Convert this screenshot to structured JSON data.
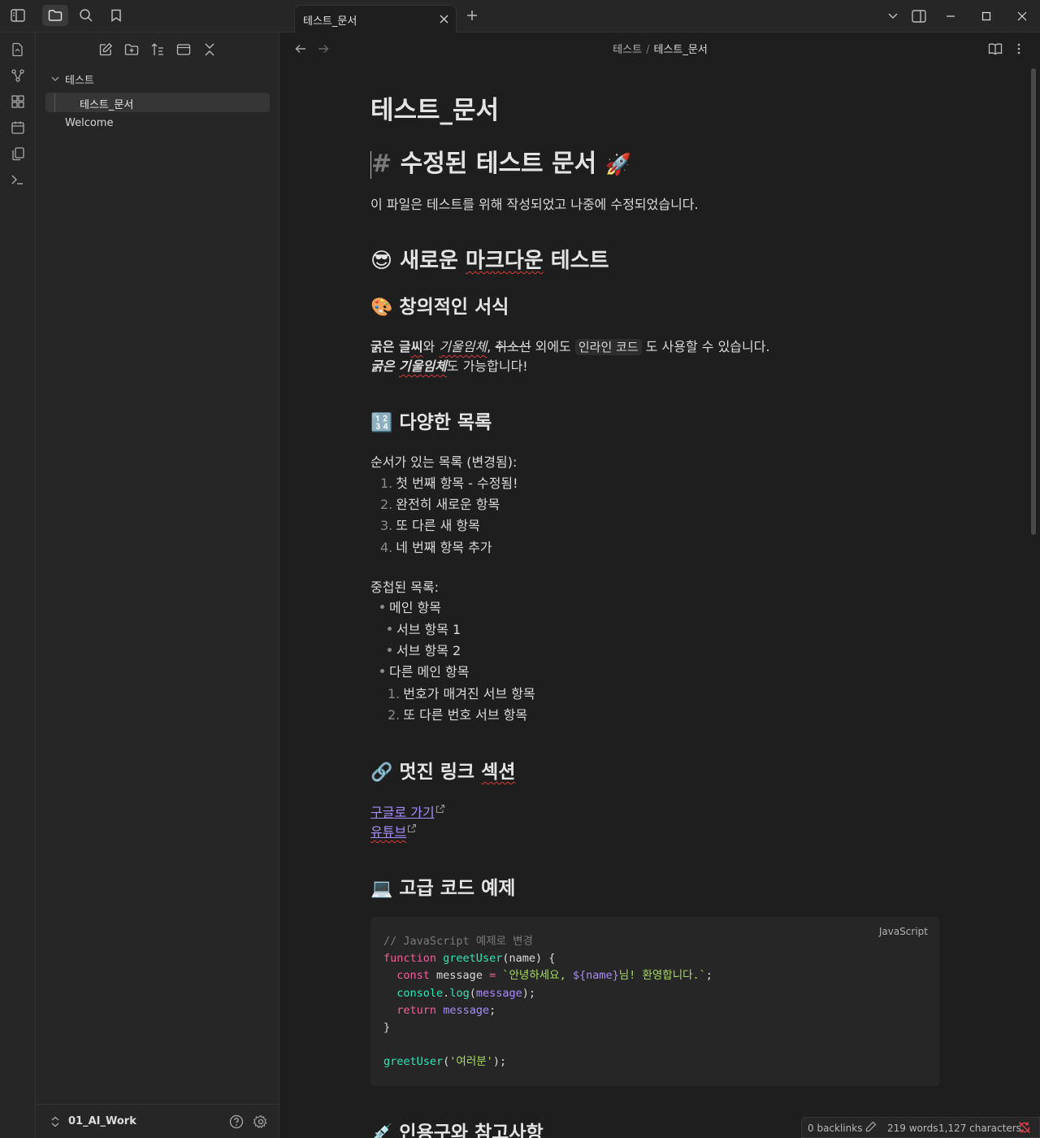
{
  "titlebar": {
    "tab_title": "테스트_문서"
  },
  "sidebar": {
    "folder": "테스트",
    "files": [
      "테스트_문서",
      "Welcome"
    ],
    "vault_name": "01_AI_Work"
  },
  "header": {
    "breadcrumb_parent": "테스트",
    "breadcrumb_sep": "/",
    "breadcrumb_current": "테스트_문서"
  },
  "doc": {
    "inline_title": "테스트_문서",
    "h1_hash": "#",
    "h1": "수정된 테스트 문서",
    "h1_emoji": "🚀",
    "intro": "이 파일은 테스트를 위해 작성되었고 나중에 수정되었습니다.",
    "h2_emoji": "😎",
    "h2_a": "새로운",
    "h2_b": "마크다운",
    "h2_c": "테스트",
    "h3_format_emoji": "🎨",
    "h3_format": "창의적인 서식",
    "fmt_line1": {
      "bold_a": "굵은 글",
      "bold_b": "씨",
      "t1": "와 ",
      "italic_a": "기울임체",
      "t2": ", ",
      "strike": "취소선",
      "t3": " 외에도 ",
      "code": "인라인 코드",
      "t4": " 도 사용할 수 있습니다."
    },
    "fmt_line2": {
      "bi_a": "굵은 ",
      "bi_b": "기울임체",
      "t": "도 가능합니다!"
    },
    "h3_list_emoji": "🔢",
    "h3_list": "다양한 목록",
    "ordered_label": "순서가 있는 목록 (변경됨):",
    "ordered": [
      "첫 번째 항목 - 수정됨!",
      "완전히 새로운 항목",
      "또 다른 새 항목",
      "네 번째 항목 추가"
    ],
    "nested_label": "중첩된 목록:",
    "nested": {
      "main1": "메인 항목",
      "sub1": "서브 항목 1",
      "sub2": "서브 항목 2",
      "main2": "다른 메인 항목",
      "num1": "번호가 매겨진 서브 항목",
      "num2": "또 다른 번호 서브 항목"
    },
    "h3_link_emoji": "🔗",
    "h3_link_a": "멋진 링크",
    "h3_link_b": "섹션",
    "links": [
      "구글로 가기",
      "유튜브"
    ],
    "h3_code_emoji": "💻",
    "h3_code": "고급 코드 예제",
    "code_lang": "JavaScript",
    "code": {
      "comment": "// JavaScript 예제로 변경",
      "kw_function": "function",
      "fn_name": "greetUser",
      "params": "(name) {",
      "kw_const": "const",
      "var_message": "message",
      "op_eq": "=",
      "tpl_start": "`안녕하세요, ",
      "tpl_expr": "${name}",
      "tpl_end": "님! 환영합니다.`",
      "semi": ";",
      "console": "console",
      "log": "log",
      "log_arg": "message",
      "log_close": ");",
      "kw_return": "return",
      "ret_val": "message",
      "close_brace": "}",
      "call_fn": "greetUser",
      "call_open": "(",
      "call_arg": "'여러분'",
      "call_close": ");"
    },
    "h3_quote_emoji": "💉",
    "h3_quote": "인용구와 참고사항"
  },
  "status": {
    "backlinks": "0 backlinks",
    "words": "219 words",
    "chars": "1,127 characters"
  },
  "colors": {
    "accent": "#a88bfa",
    "code_keyword": "#f0609b",
    "code_function": "#2ee6b6",
    "code_string": "#a8dc60",
    "sync_error": "#e0424a"
  },
  "icons": [
    "sidebar-toggle-icon",
    "folder-icon",
    "search-icon",
    "bookmark-icon",
    "close-icon",
    "plus-icon",
    "chevron-down-icon",
    "split-view-icon",
    "minimize-icon",
    "maximize-icon",
    "window-close-icon",
    "files-icon",
    "graph-icon",
    "canvas-icon",
    "calendar-icon",
    "copy-icon",
    "terminal-icon",
    "new-note-icon",
    "new-folder-icon",
    "sort-icon",
    "collapse-icon",
    "collapse-all-icon",
    "vault-switch-icon",
    "help-icon",
    "settings-icon",
    "back-arrow-icon",
    "forward-arrow-icon",
    "reading-view-icon",
    "more-options-icon",
    "external-link-icon",
    "edit-pencil-icon",
    "sync-off-icon"
  ]
}
